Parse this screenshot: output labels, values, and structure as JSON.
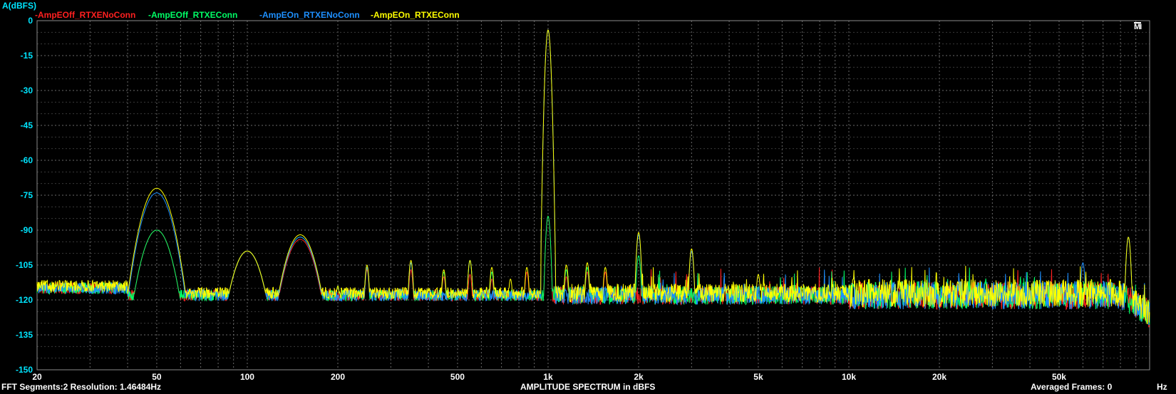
{
  "chart_data": {
    "type": "line",
    "title": "AMPLITUDE SPECTRUM in dBFS",
    "ylabel": "A(dBFS)",
    "xlabel": "Hz",
    "xscale": "log",
    "xlim": [
      20,
      100000
    ],
    "ylim": [
      -150,
      0
    ],
    "grid": true,
    "legend_position": "top-left",
    "yticks": [
      "0",
      "-15",
      "-30",
      "-45",
      "-60",
      "-75",
      "-90",
      "-105",
      "-120",
      "-135",
      "-150"
    ],
    "ytick_values": [
      0,
      -15,
      -30,
      -45,
      -60,
      -75,
      -90,
      -105,
      -120,
      -135,
      -150
    ],
    "xticks": [
      "20",
      "50",
      "100",
      "200",
      "500",
      "1k",
      "2k",
      "5k",
      "10k",
      "20k",
      "50k"
    ],
    "xtick_values": [
      20,
      50,
      100,
      200,
      500,
      1000,
      2000,
      5000,
      10000,
      20000,
      50000
    ],
    "series": [
      {
        "name": "-AmpEOff_RTXENoConn",
        "color": "#ff2020",
        "noise_floor_db": -118,
        "peaks": [
          [
            50,
            -90
          ],
          [
            100,
            -99
          ],
          [
            150,
            -94
          ],
          [
            250,
            -107
          ],
          [
            350,
            -107
          ],
          [
            450,
            -110
          ],
          [
            550,
            -109
          ],
          [
            650,
            -111
          ],
          [
            850,
            -108
          ],
          [
            1000,
            -84
          ],
          [
            1150,
            -110
          ],
          [
            1350,
            -108
          ],
          [
            1550,
            -108
          ],
          [
            2350,
            -110
          ]
        ]
      },
      {
        "name": "-AmpEOff_RTXEConn",
        "color": "#00ff66",
        "noise_floor_db": -118,
        "peaks": [
          [
            50,
            -90
          ],
          [
            100,
            -99
          ],
          [
            150,
            -93
          ],
          [
            200,
            -114
          ],
          [
            250,
            -106
          ],
          [
            350,
            -104
          ],
          [
            450,
            -108
          ],
          [
            550,
            -103
          ],
          [
            650,
            -108
          ],
          [
            1000,
            -84
          ],
          [
            1150,
            -107
          ],
          [
            1350,
            -106
          ],
          [
            2000,
            -101
          ]
        ]
      },
      {
        "name": "-AmpEOn_RTXENoConn",
        "color": "#1e90ff",
        "noise_floor_db": -118,
        "peaks": [
          [
            50,
            -74
          ],
          [
            100,
            -99
          ],
          [
            150,
            -93
          ],
          [
            250,
            -106
          ],
          [
            350,
            -104
          ],
          [
            550,
            -103
          ],
          [
            1000,
            -4
          ],
          [
            2000,
            -92
          ],
          [
            3000,
            -99
          ],
          [
            60000,
            -104
          ],
          [
            85000,
            -93
          ]
        ]
      },
      {
        "name": "-AmpEOn_RTXEConn",
        "color": "#ffff00",
        "noise_floor_db": -117,
        "peaks": [
          [
            50,
            -72
          ],
          [
            100,
            -99
          ],
          [
            150,
            -92
          ],
          [
            200,
            -114
          ],
          [
            250,
            -105
          ],
          [
            350,
            -103
          ],
          [
            450,
            -107
          ],
          [
            550,
            -103
          ],
          [
            650,
            -106
          ],
          [
            750,
            -111
          ],
          [
            850,
            -106
          ],
          [
            1000,
            -4
          ],
          [
            1150,
            -105
          ],
          [
            1350,
            -104
          ],
          [
            1550,
            -106
          ],
          [
            2000,
            -91
          ],
          [
            3000,
            -98
          ],
          [
            5000,
            -109
          ],
          [
            85000,
            -93
          ]
        ]
      }
    ]
  },
  "footer": {
    "left": "FFT Segments:2   Resolution: 1.46484Hz",
    "center": "AMPLITUDE SPECTRUM in dBFS",
    "right": "Averaged Frames: 0",
    "unit": "Hz"
  },
  "logo_text": "MI"
}
